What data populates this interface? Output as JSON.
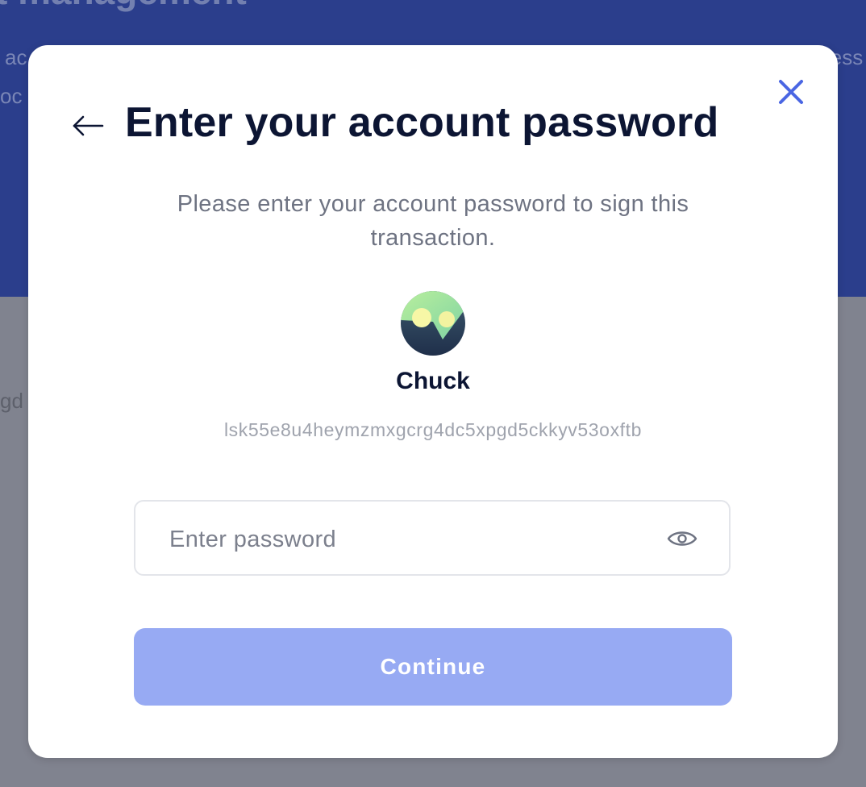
{
  "background": {
    "title_fragment": "t management",
    "line1_fragment": "ac",
    "line2_fragment": "oc",
    "right_fragment": "less",
    "grey_fragment": "gd"
  },
  "modal": {
    "title": "Enter your account password",
    "subtitle": "Please enter your account password to sign this transaction.",
    "account": {
      "name": "Chuck",
      "address": "lsk55e8u4heymzmxgcrg4dc5xpgd5ckkyv53oxftb"
    },
    "password": {
      "placeholder": "Enter password",
      "value": ""
    },
    "continue_label": "Continue"
  },
  "colors": {
    "header_bg": "#2b3e8c",
    "overlay_bg": "#80838f",
    "title_text": "#0c1533",
    "accent": "#4a66e3",
    "continue_disabled": "#97aaf3"
  },
  "icons": {
    "back": "arrow-left-icon",
    "close": "close-icon",
    "reveal": "eye-icon"
  }
}
